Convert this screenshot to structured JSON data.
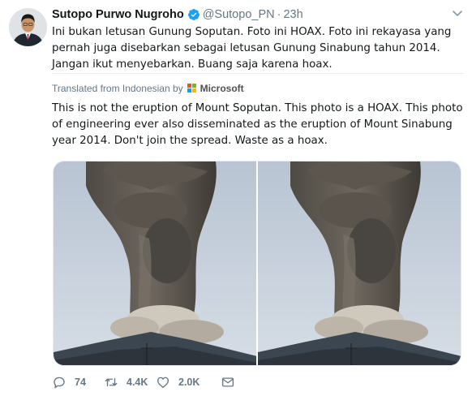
{
  "author": {
    "name": "Sutopo Purwo Nugroho",
    "handle": "@Sutopo_PN",
    "separator": "·",
    "time": "23h",
    "verified": true,
    "avatar": "avatar-photo"
  },
  "tweet": {
    "text": "Ini bukan letusan Gunung Soputan. Foto ini HOAX. Foto ini rekayasa yang pernah juga disebarkan sebagai letusan Gunung Sinabung tahun 2014. Jangan ikut menyebarkan. Buang saja karena hoax.",
    "translated_label": "Translated from Indonesian by",
    "translator": "Microsoft",
    "translation": "This is not the eruption of Mount Soputan. This photo is a HOAX. This photo of engineering ever also disseminated as the eruption of Mount Sinabung year 2014. Don't join the spread. Waste as a hoax."
  },
  "media": {
    "photos": [
      "eruption-photo-left",
      "eruption-photo-right"
    ]
  },
  "actions": {
    "reply_count": "74",
    "retweet_count": "4.4K",
    "like_count": "2.0K"
  },
  "icons": {
    "reply": "reply-icon",
    "retweet": "retweet-icon",
    "like": "heart-icon",
    "dm": "envelope-icon",
    "menu": "chevron-down-icon",
    "verified": "verified-badge-icon"
  },
  "colors": {
    "verified": "#1da1f2",
    "muted": "#657786",
    "text": "#14171a",
    "ms_red": "#f25022",
    "ms_green": "#7fba00",
    "ms_blue": "#00a4ef",
    "ms_yellow": "#ffb900"
  }
}
